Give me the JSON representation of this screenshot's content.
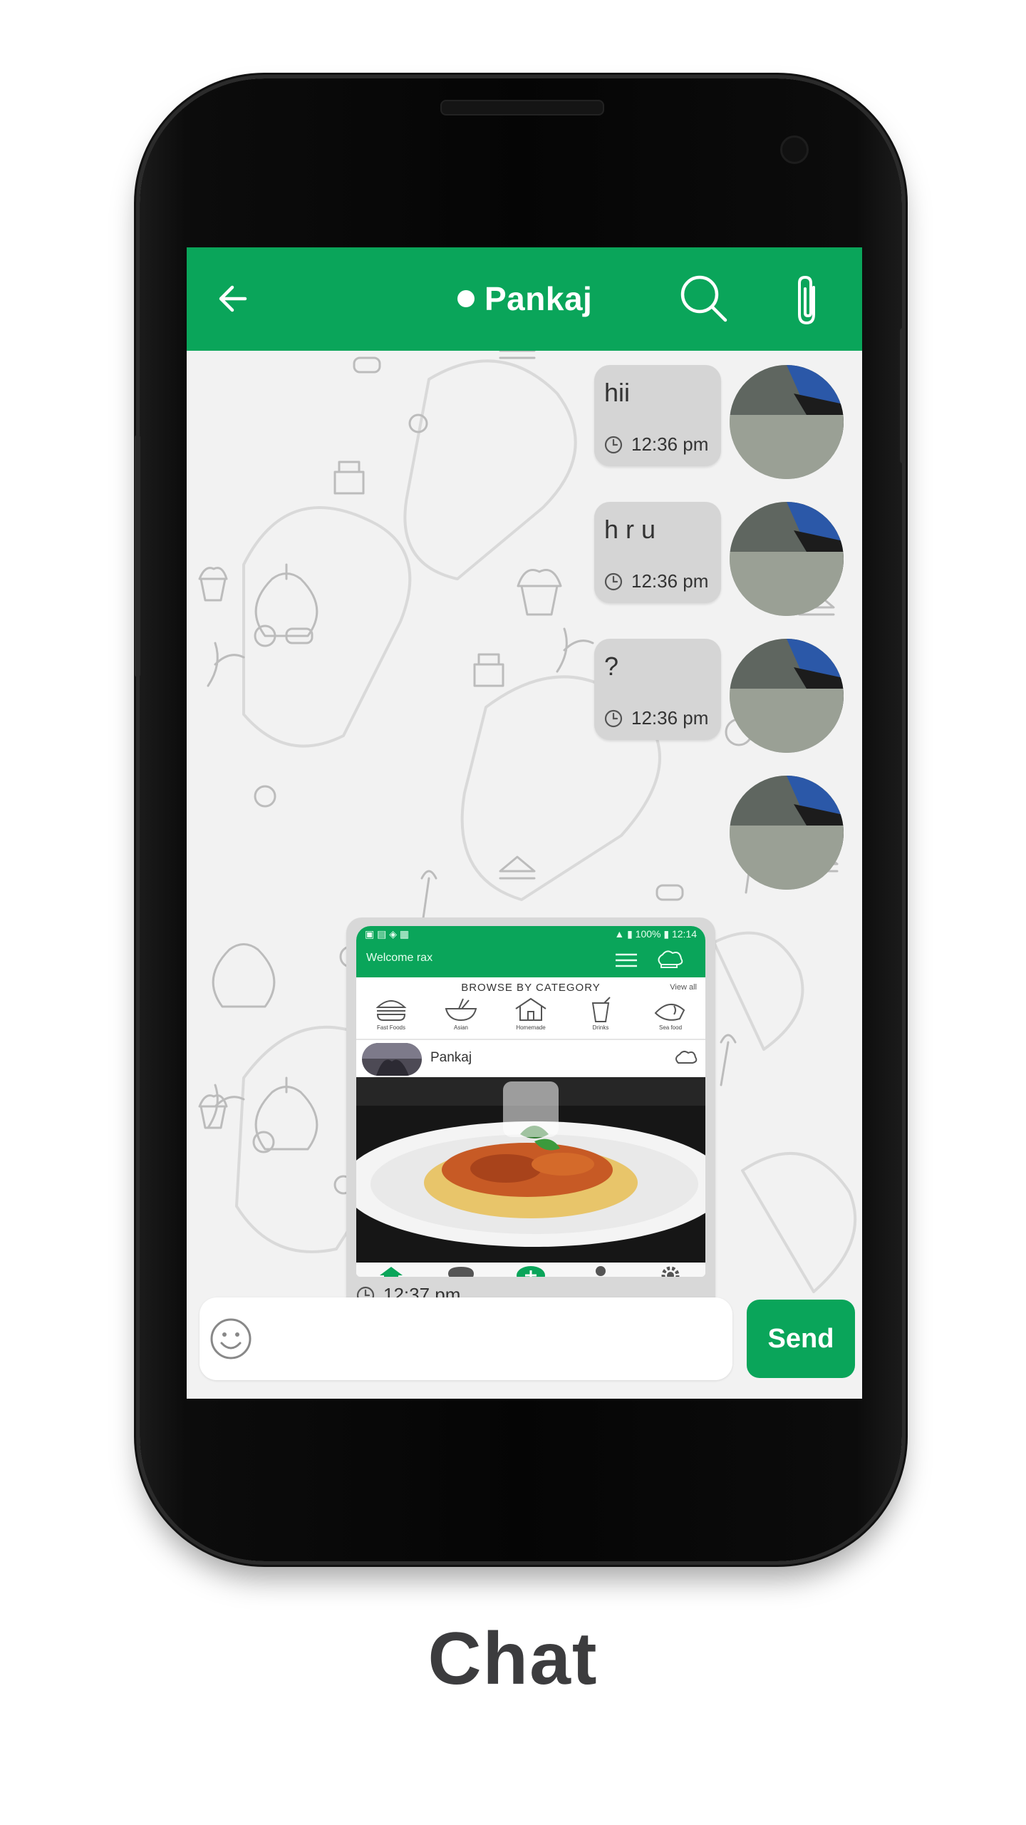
{
  "header": {
    "contact_name": "Pankaj",
    "online": true
  },
  "messages": [
    {
      "text": "hii",
      "time": "12:36 pm"
    },
    {
      "text": "h r u",
      "time": "12:36 pm"
    },
    {
      "text": "?",
      "time": "12:36 pm"
    }
  ],
  "image_message": {
    "time": "12:37 pm",
    "preview": {
      "welcome": "Welcome rax",
      "section_title": "BROWSE BY CATEGORY",
      "view_all": "View all",
      "categories": [
        "Fast Foods",
        "Asian",
        "Homemade",
        "Drinks",
        "Sea food"
      ],
      "post_author": "Pankaj"
    }
  },
  "composer": {
    "placeholder": "",
    "send_label": "Send"
  },
  "caption": "Chat",
  "colors": {
    "accent": "#0aa55a",
    "bubble": "#d5d5d5",
    "background": "#f2f2f2"
  }
}
